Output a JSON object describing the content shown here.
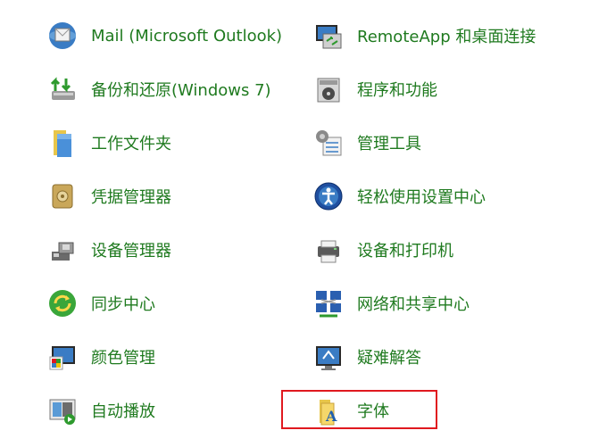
{
  "items_left": [
    {
      "label": "Mail (Microsoft Outlook)",
      "icon": "mail-icon"
    },
    {
      "label": "备份和还原(Windows 7)",
      "icon": "backup-restore-icon"
    },
    {
      "label": "工作文件夹",
      "icon": "work-folders-icon"
    },
    {
      "label": "凭据管理器",
      "icon": "credential-manager-icon"
    },
    {
      "label": "设备管理器",
      "icon": "device-manager-icon"
    },
    {
      "label": "同步中心",
      "icon": "sync-center-icon"
    },
    {
      "label": "颜色管理",
      "icon": "color-management-icon"
    },
    {
      "label": "自动播放",
      "icon": "autoplay-icon"
    }
  ],
  "items_right": [
    {
      "label": "RemoteApp 和桌面连接",
      "icon": "remoteapp-icon"
    },
    {
      "label": "程序和功能",
      "icon": "programs-features-icon"
    },
    {
      "label": "管理工具",
      "icon": "admin-tools-icon"
    },
    {
      "label": "轻松使用设置中心",
      "icon": "ease-of-access-icon"
    },
    {
      "label": "设备和打印机",
      "icon": "devices-printers-icon"
    },
    {
      "label": "网络和共享中心",
      "icon": "network-sharing-icon"
    },
    {
      "label": "疑难解答",
      "icon": "troubleshooting-icon"
    },
    {
      "label": "字体",
      "icon": "fonts-icon"
    }
  ],
  "colors": {
    "label": "#1f7a1f",
    "highlight": "#e0191f"
  }
}
